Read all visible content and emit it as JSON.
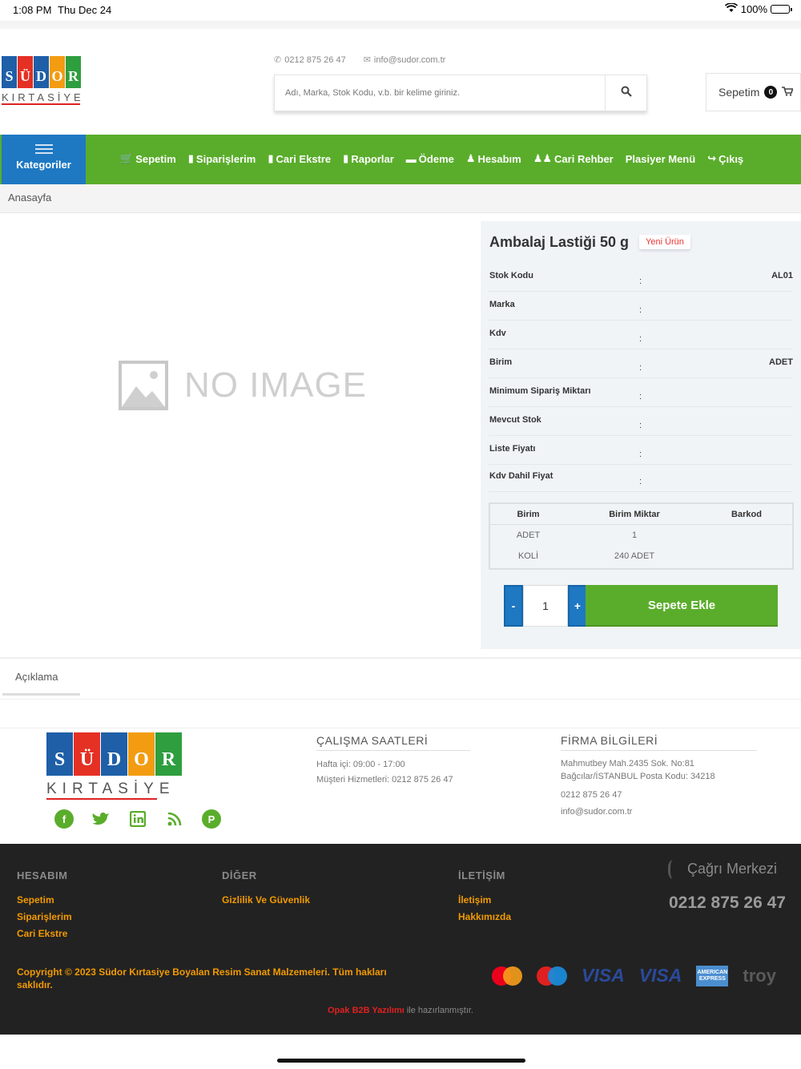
{
  "status": {
    "time": "1:08 PM",
    "date": "Thu Dec 24",
    "battery": "100%"
  },
  "brand": {
    "tiles": [
      "S",
      "Ü",
      "D",
      "O",
      "R"
    ],
    "tile_colors": [
      "#1e5fa8",
      "#e53024",
      "#1e5fa8",
      "#f39c12",
      "#2e9e3f"
    ],
    "sub": "KIRTASİYE"
  },
  "header": {
    "phone": "0212 875 26 47",
    "email": "info@sudor.com.tr",
    "search_placeholder": "Adı, Marka, Stok Kodu, v.b. bir kelime giriniz.",
    "cart_label": "Sepetim",
    "cart_count": "0"
  },
  "nav": {
    "categories_label": "Kategoriler",
    "items": [
      "Sepetim",
      "Siparişlerim",
      "Cari Ekstre",
      "Raporlar",
      "Ödeme",
      "Hesabım",
      "Cari Rehber",
      "Plasiyer Menü",
      "Çıkış"
    ]
  },
  "breadcrumb": "Anasayfa",
  "image": {
    "placeholder_text": "NO IMAGE"
  },
  "product": {
    "title": "Ambalaj Lastiği 50 g",
    "tag": "Yeni Ürün",
    "attributes": [
      {
        "label": "Stok Kodu",
        "value": "AL01"
      },
      {
        "label": "Marka",
        "value": ""
      },
      {
        "label": "Kdv",
        "value": ""
      },
      {
        "label": "Birim",
        "value": "ADET"
      },
      {
        "label": "Minimum Sipariş Miktarı",
        "value": ""
      },
      {
        "label": "Mevcut Stok",
        "value": ""
      },
      {
        "label": "Liste Fiyatı",
        "value": ""
      },
      {
        "label": "Kdv Dahil Fiyat",
        "value": ""
      }
    ],
    "colon": ":",
    "units_headers": [
      "Birim",
      "Birim Miktar",
      "Barkod"
    ],
    "units_rows": [
      [
        "ADET",
        "1",
        ""
      ],
      [
        "KOLİ",
        "240 ADET",
        ""
      ]
    ],
    "qty_minus": "-",
    "qty_plus": "+",
    "qty_value": "1",
    "add_to_cart": "Sepete Ekle"
  },
  "description_tab": "Açıklama",
  "footer": {
    "hours_title": "ÇALIŞMA SAATLERİ",
    "hours_lines": [
      "Hafta içi: 09:00 - 17:00",
      "Müşteri Hizmetleri: 0212 875 26 47"
    ],
    "company_title": "FİRMA BİLGİLERİ",
    "company_lines": [
      "Mahmutbey Mah.2435 Sok. No:81",
      "Bağcılar/İSTANBUL Posta Kodu: 34218",
      "0212 875 26 47",
      "info@sudor.com.tr"
    ],
    "social_icons": [
      "facebook-icon",
      "twitter-icon",
      "linkedin-icon",
      "rss-icon",
      "pinterest-icon"
    ]
  },
  "dark_footer": {
    "col1_title": "HESABIM",
    "col1_links": [
      "Sepetim",
      "Siparişlerim",
      "Cari Ekstre"
    ],
    "col2_title": "DİĞER",
    "col2_links": [
      "Gizlilik Ve Güvenlik"
    ],
    "col3_title": "İLETİŞİM",
    "col3_links": [
      "İletişim",
      "Hakkımızda"
    ],
    "call_center": "Çağrı Merkezi",
    "call_phone": "0212 875 26 47",
    "copyright": "Copyright © 2023 Südor Kırtasiye Boyalan Resim Sanat Malzemeleri. Tüm hakları saklıdır.",
    "payments": {
      "visa1": "VISA",
      "visa2": "VISA",
      "amex": "AMERICAN EXPRESS",
      "troy": "troy"
    },
    "made_by_brand": "Opak B2B Yazılımı",
    "made_by_rest": " ile hazırlanmıştır."
  }
}
